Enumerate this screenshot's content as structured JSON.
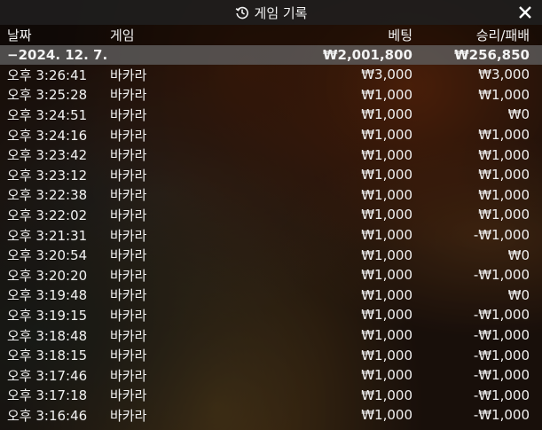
{
  "title": "게임 기록",
  "icons": {
    "history": "history-icon",
    "close": "close-icon"
  },
  "columns": {
    "date": "날짜",
    "game": "게임",
    "bet": "베팅",
    "result": "승리/패배"
  },
  "summary": {
    "date": "−2024. 12. 7.",
    "bet": "₩2,001,800",
    "result": "₩256,850"
  },
  "rows": [
    {
      "time": "오후 3:26:41",
      "game": "바카라",
      "bet": "₩3,000",
      "result": "₩3,000"
    },
    {
      "time": "오후 3:25:28",
      "game": "바카라",
      "bet": "₩1,000",
      "result": "₩1,000"
    },
    {
      "time": "오후 3:24:51",
      "game": "바카라",
      "bet": "₩1,000",
      "result": "₩0"
    },
    {
      "time": "오후 3:24:16",
      "game": "바카라",
      "bet": "₩1,000",
      "result": "₩1,000"
    },
    {
      "time": "오후 3:23:42",
      "game": "바카라",
      "bet": "₩1,000",
      "result": "₩1,000"
    },
    {
      "time": "오후 3:23:12",
      "game": "바카라",
      "bet": "₩1,000",
      "result": "₩1,000"
    },
    {
      "time": "오후 3:22:38",
      "game": "바카라",
      "bet": "₩1,000",
      "result": "₩1,000"
    },
    {
      "time": "오후 3:22:02",
      "game": "바카라",
      "bet": "₩1,000",
      "result": "₩1,000"
    },
    {
      "time": "오후 3:21:31",
      "game": "바카라",
      "bet": "₩1,000",
      "result": "-₩1,000"
    },
    {
      "time": "오후 3:20:54",
      "game": "바카라",
      "bet": "₩1,000",
      "result": "₩0"
    },
    {
      "time": "오후 3:20:20",
      "game": "바카라",
      "bet": "₩1,000",
      "result": "-₩1,000"
    },
    {
      "time": "오후 3:19:48",
      "game": "바카라",
      "bet": "₩1,000",
      "result": "₩0"
    },
    {
      "time": "오후 3:19:15",
      "game": "바카라",
      "bet": "₩1,000",
      "result": "-₩1,000"
    },
    {
      "time": "오후 3:18:48",
      "game": "바카라",
      "bet": "₩1,000",
      "result": "-₩1,000"
    },
    {
      "time": "오후 3:18:15",
      "game": "바카라",
      "bet": "₩1,000",
      "result": "-₩1,000"
    },
    {
      "time": "오후 3:17:46",
      "game": "바카라",
      "bet": "₩1,000",
      "result": "-₩1,000"
    },
    {
      "time": "오후 3:17:18",
      "game": "바카라",
      "bet": "₩1,000",
      "result": "-₩1,000"
    },
    {
      "time": "오후 3:16:46",
      "game": "바카라",
      "bet": "₩1,000",
      "result": "-₩1,000"
    }
  ]
}
